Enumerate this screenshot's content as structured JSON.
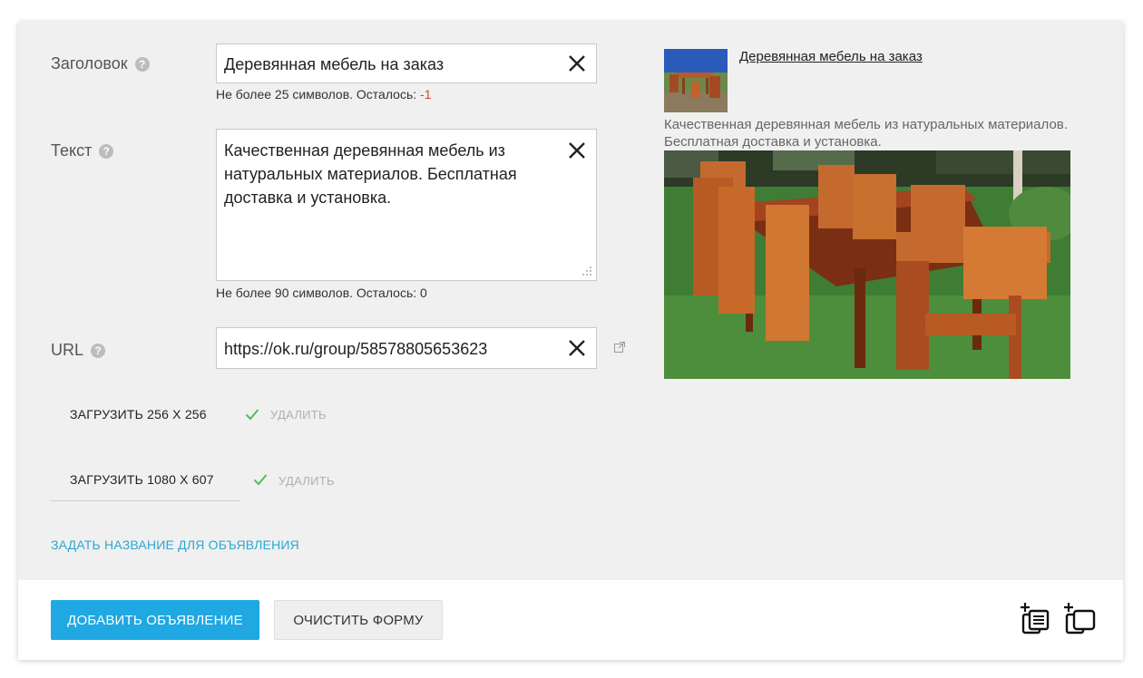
{
  "form": {
    "title_label": "Заголовок",
    "title_value": "Деревянная мебель на заказ",
    "title_hint_prefix": "Не более 25 символов. Осталось:",
    "title_hint_remaining": "-1",
    "text_label": "Текст",
    "text_value": "Качественная деревянная мебель из натуральных материалов. Бесплатная доставка и установка.",
    "text_hint": "Не более 90 символов. Осталось: 0",
    "url_label": "URL",
    "url_value": "https://ok.ru/group/58578805653623",
    "help_glyph": "?"
  },
  "uploads": {
    "small_label": "ЗАГРУЗИТЬ 256 X 256",
    "large_label": "ЗАГРУЗИТЬ 1080 X 607",
    "delete_label": "УДАЛИТЬ",
    "check_color": "#5cb85c"
  },
  "links": {
    "set_name": "ЗАДАТЬ НАЗВАНИЕ ДЛЯ ОБЪЯВЛЕНИЯ"
  },
  "preview": {
    "title": "Деревянная мебель на заказ",
    "text": "Качественная деревянная мебель из натуральных материалов. Бесплатная доставка и установка."
  },
  "footer": {
    "add_button": "ДОБАВИТЬ ОБЪЯВЛЕНИЕ",
    "clear_button": "ОЧИСТИТЬ ФОРМУ",
    "accent_color": "#1fa8e1"
  },
  "icons": [
    "help-icon",
    "close-icon",
    "external-link-icon",
    "check-icon",
    "add-ad-icon",
    "add-copy-icon",
    "resize-grip-icon"
  ]
}
